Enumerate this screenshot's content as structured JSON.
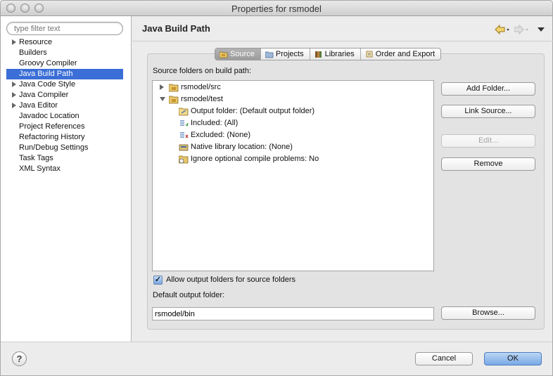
{
  "window": {
    "title": "Properties for rsmodel"
  },
  "sidebar": {
    "filter_placeholder": "type filter text",
    "items": [
      {
        "label": "Resource",
        "expandable": true,
        "selected": false
      },
      {
        "label": "Builders",
        "expandable": false,
        "selected": false
      },
      {
        "label": "Groovy Compiler",
        "expandable": false,
        "selected": false
      },
      {
        "label": "Java Build Path",
        "expandable": false,
        "selected": true
      },
      {
        "label": "Java Code Style",
        "expandable": true,
        "selected": false
      },
      {
        "label": "Java Compiler",
        "expandable": true,
        "selected": false
      },
      {
        "label": "Java Editor",
        "expandable": true,
        "selected": false
      },
      {
        "label": "Javadoc Location",
        "expandable": false,
        "selected": false
      },
      {
        "label": "Project References",
        "expandable": false,
        "selected": false
      },
      {
        "label": "Refactoring History",
        "expandable": false,
        "selected": false
      },
      {
        "label": "Run/Debug Settings",
        "expandable": false,
        "selected": false
      },
      {
        "label": "Task Tags",
        "expandable": false,
        "selected": false
      },
      {
        "label": "XML Syntax",
        "expandable": false,
        "selected": false
      }
    ]
  },
  "page": {
    "title": "Java Build Path",
    "tabs": [
      {
        "label": "Source",
        "icon": "source-folder-icon",
        "active": true
      },
      {
        "label": "Projects",
        "icon": "projects-icon",
        "active": false
      },
      {
        "label": "Libraries",
        "icon": "libraries-icon",
        "active": false
      },
      {
        "label": "Order and Export",
        "icon": "order-export-icon",
        "active": false
      }
    ],
    "source_label": "Source folders on build path:",
    "folders": [
      {
        "label": "rsmodel/src",
        "expanded": false
      },
      {
        "label": "rsmodel/test",
        "expanded": true
      }
    ],
    "test_children": [
      {
        "label": "Output folder: (Default output folder)",
        "icon": "output-folder-icon"
      },
      {
        "label": "Included: (All)",
        "icon": "included-filter-icon"
      },
      {
        "label": "Excluded: (None)",
        "icon": "excluded-filter-icon"
      },
      {
        "label": "Native library location: (None)",
        "icon": "native-library-icon"
      },
      {
        "label": "Ignore optional compile problems: No",
        "icon": "ignore-problems-icon"
      }
    ],
    "buttons": {
      "add_folder": "Add Folder...",
      "link_source": "Link Source...",
      "edit": "Edit...",
      "remove": "Remove",
      "browse": "Browse..."
    },
    "allow_output_label": "Allow output folders for source folders",
    "allow_output_checked": true,
    "default_output_label": "Default output folder:",
    "default_output_value": "rsmodel/bin"
  },
  "footer": {
    "cancel_label": "Cancel",
    "ok_label": "OK",
    "help_symbol": "?"
  },
  "colors": {
    "selection": "#3b6ed6",
    "default_button": "#78a9e6"
  }
}
